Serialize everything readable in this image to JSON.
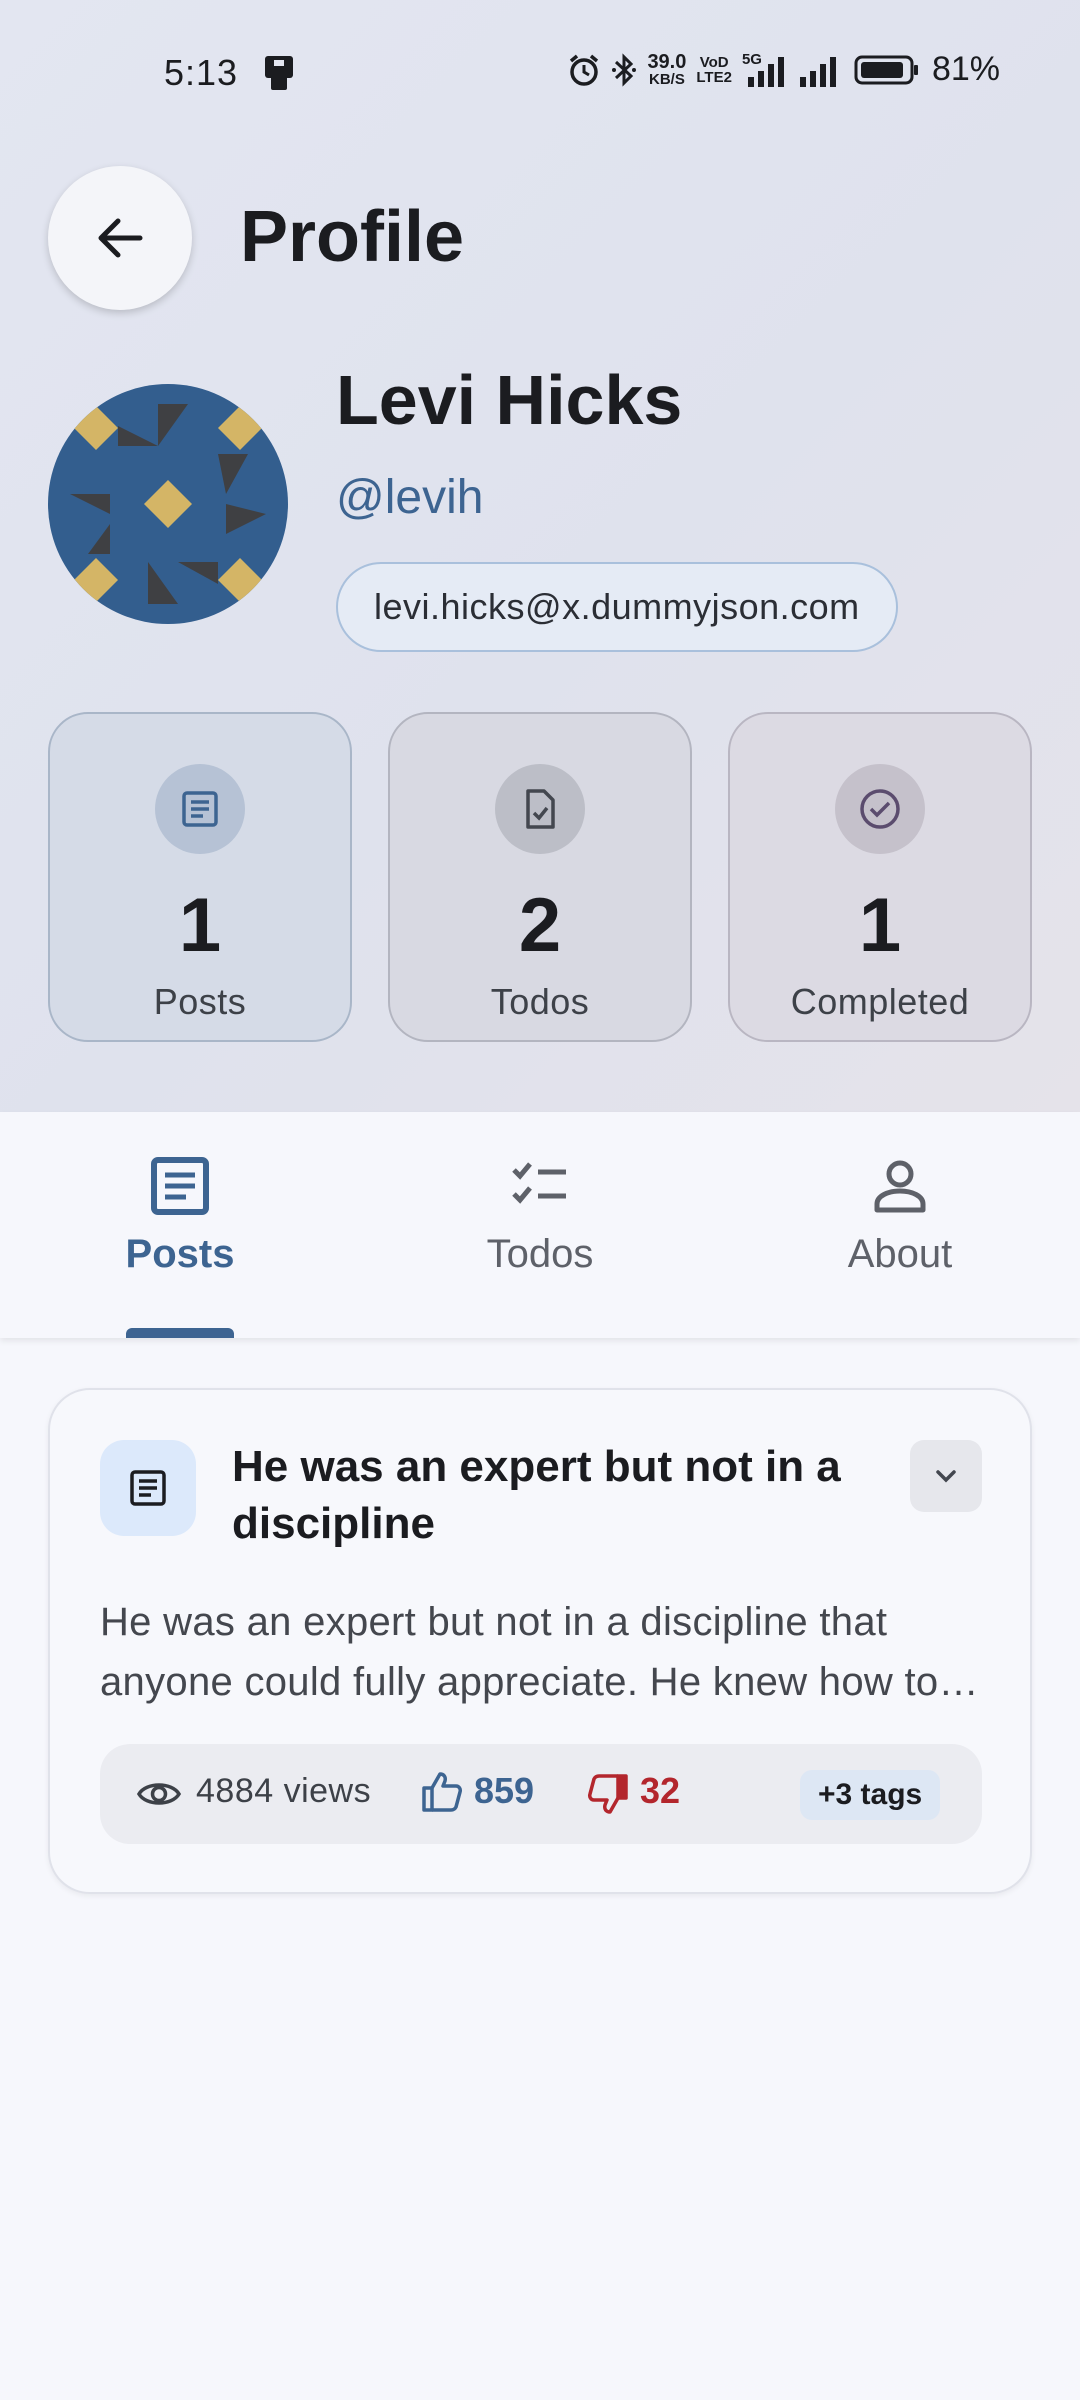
{
  "status_bar": {
    "time": "5:13",
    "net_speed_value": "39.0",
    "net_speed_unit": "KB/S",
    "volte_top": "VoD",
    "volte_bottom": "LTE2",
    "network_type": "5G",
    "battery_percent": "81%",
    "icons": [
      "app-notification-icon",
      "alarm-icon",
      "bluetooth-icon",
      "signal-icon",
      "signal-icon",
      "battery-icon"
    ]
  },
  "app_bar": {
    "title": "Profile",
    "back_icon": "arrow-left-icon"
  },
  "profile": {
    "name": "Levi Hicks",
    "handle": "@levih",
    "email": "levi.hicks@x.dummyjson.com"
  },
  "stats": [
    {
      "icon": "article-icon",
      "value": "1",
      "label": "Posts"
    },
    {
      "icon": "task-file-icon",
      "value": "2",
      "label": "Todos"
    },
    {
      "icon": "check-circle-icon",
      "value": "1",
      "label": "Completed"
    }
  ],
  "tabs": [
    {
      "icon": "article-icon",
      "label": "Posts",
      "selected": true
    },
    {
      "icon": "checklist-icon",
      "label": "Todos",
      "selected": false
    },
    {
      "icon": "person-icon",
      "label": "About",
      "selected": false
    }
  ],
  "posts": [
    {
      "title": "He was an expert but not in a discipline",
      "body": "He was an expert but not in a discipline that anyone could fully appreciate. He knew how to hold the cone just right so that the soft serve ice cream fell into it at the precise angle to form a perfect cone each and every time.",
      "views": "4884 views",
      "likes": "859",
      "dislikes": "32",
      "tags": "+3 tags"
    }
  ],
  "colors": {
    "primary": "#3d6491",
    "error": "#b3262d",
    "avatar_bg": "#335e8e",
    "avatar_gold": "#d4b566"
  }
}
